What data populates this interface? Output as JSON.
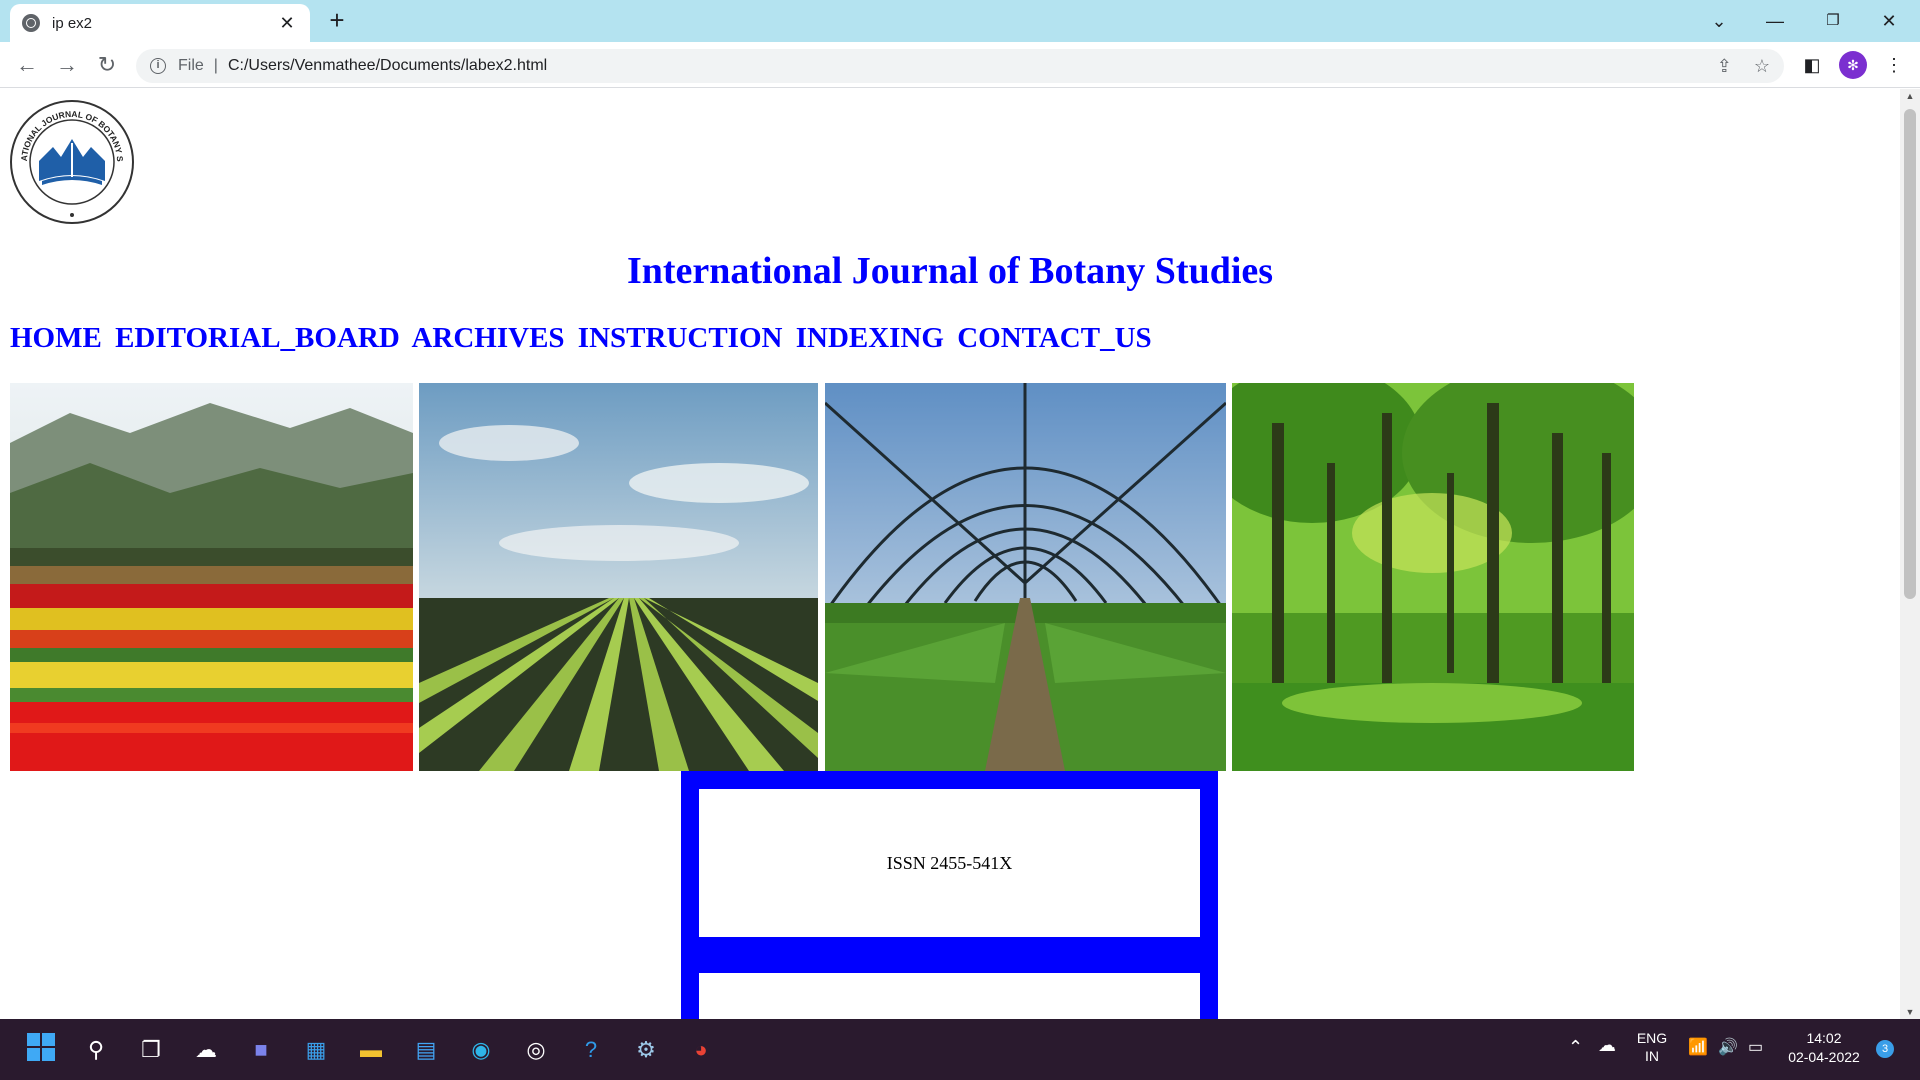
{
  "browser": {
    "tab_title": "ip ex2",
    "tab_close": "✕",
    "new_tab": "+",
    "omnibox": {
      "scheme_label": "File",
      "url": "C:/Users/Venmathee/Documents/labex2.html"
    }
  },
  "page": {
    "heading": "International Journal of Botany Studies",
    "logo_text": "INTERNATIONAL JOURNAL OF BOTANY STUDIES",
    "nav": [
      "HOME",
      "EDITORIAL_BOARD",
      "ARCHIVES",
      "INSTRUCTION",
      "INDEXING",
      "CONTACT_US"
    ],
    "images": [
      "tulip-field",
      "crop-rows-field",
      "greenhouse",
      "green-forest"
    ],
    "issn": "ISSN 2455-541X",
    "accent_color": "#0000ff"
  },
  "taskbar": {
    "language": "ENG",
    "region": "IN",
    "time": "14:02",
    "date": "02-04-2022",
    "notification_count": "3"
  }
}
